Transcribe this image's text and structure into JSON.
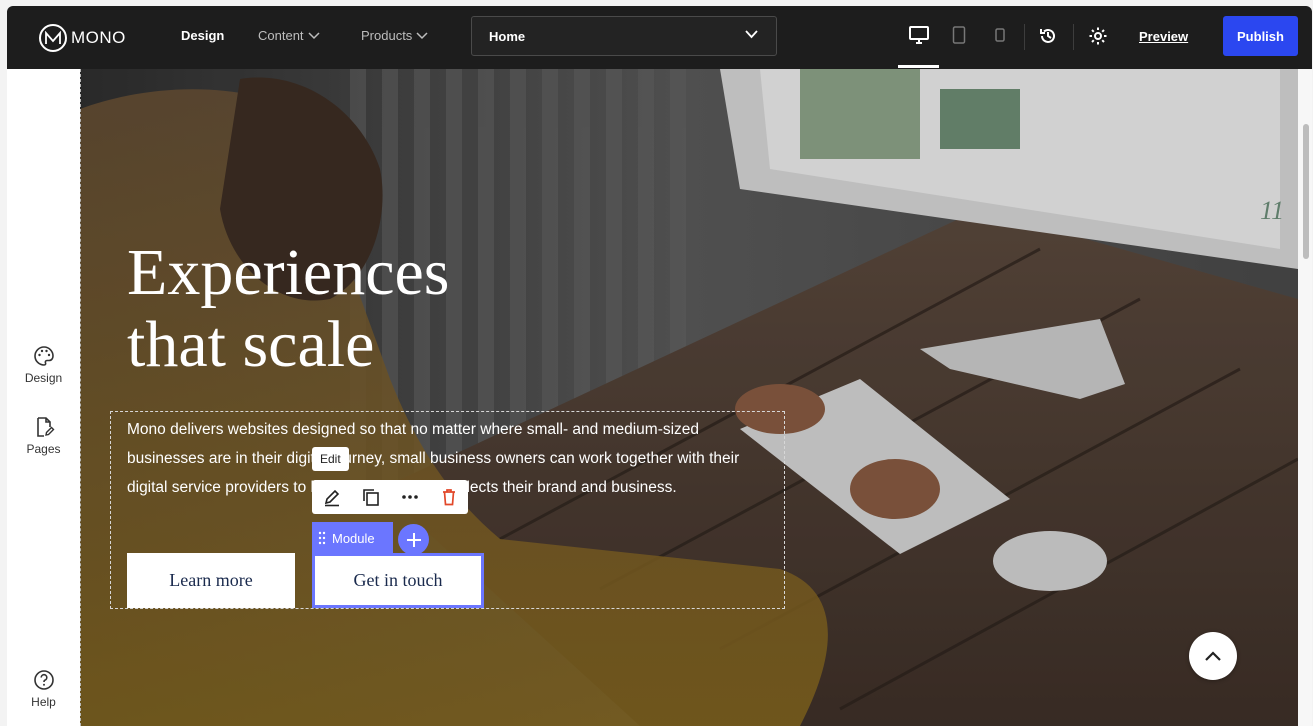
{
  "brand": {
    "name": "MONO"
  },
  "nav": {
    "design": "Design",
    "content": "Content",
    "products": "Products"
  },
  "page_select": {
    "value": "Home"
  },
  "toolbar": {
    "preview": "Preview",
    "publish": "Publish"
  },
  "sidebar": {
    "design": "Design",
    "pages": "Pages",
    "help": "Help"
  },
  "hero": {
    "title_line1": "Experiences",
    "title_line2": "that scale",
    "body": "Mono delivers websites designed so that no matter where small- and medium-sized businesses are in their digital journey, small business owners can work together with their digital service providers to have a website that reflects their brand and business.",
    "button_learn": "Learn more",
    "button_contact": "Get in touch"
  },
  "editor": {
    "tooltip": "Edit",
    "module_label": "Module"
  },
  "colors": {
    "topbar": "#1d1d1d",
    "accent": "#2b47f0",
    "selection": "#6b76ff",
    "delete": "#e2482a"
  }
}
